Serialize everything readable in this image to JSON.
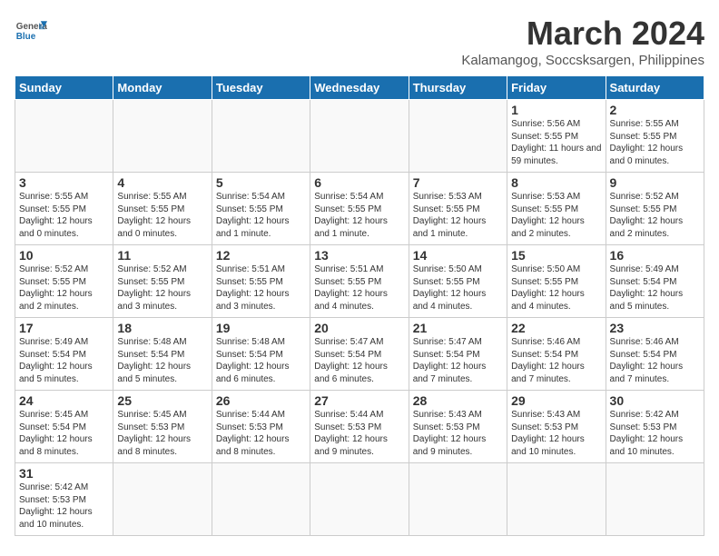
{
  "header": {
    "logo_general": "General",
    "logo_blue": "Blue",
    "month_title": "March 2024",
    "location": "Kalamangog, Soccsksargen, Philippines"
  },
  "days_of_week": [
    "Sunday",
    "Monday",
    "Tuesday",
    "Wednesday",
    "Thursday",
    "Friday",
    "Saturday"
  ],
  "weeks": [
    [
      {
        "day": "",
        "info": ""
      },
      {
        "day": "",
        "info": ""
      },
      {
        "day": "",
        "info": ""
      },
      {
        "day": "",
        "info": ""
      },
      {
        "day": "",
        "info": ""
      },
      {
        "day": "1",
        "info": "Sunrise: 5:56 AM\nSunset: 5:55 PM\nDaylight: 11 hours and 59 minutes."
      },
      {
        "day": "2",
        "info": "Sunrise: 5:55 AM\nSunset: 5:55 PM\nDaylight: 12 hours and 0 minutes."
      }
    ],
    [
      {
        "day": "3",
        "info": "Sunrise: 5:55 AM\nSunset: 5:55 PM\nDaylight: 12 hours and 0 minutes."
      },
      {
        "day": "4",
        "info": "Sunrise: 5:55 AM\nSunset: 5:55 PM\nDaylight: 12 hours and 0 minutes."
      },
      {
        "day": "5",
        "info": "Sunrise: 5:54 AM\nSunset: 5:55 PM\nDaylight: 12 hours and 1 minute."
      },
      {
        "day": "6",
        "info": "Sunrise: 5:54 AM\nSunset: 5:55 PM\nDaylight: 12 hours and 1 minute."
      },
      {
        "day": "7",
        "info": "Sunrise: 5:53 AM\nSunset: 5:55 PM\nDaylight: 12 hours and 1 minute."
      },
      {
        "day": "8",
        "info": "Sunrise: 5:53 AM\nSunset: 5:55 PM\nDaylight: 12 hours and 2 minutes."
      },
      {
        "day": "9",
        "info": "Sunrise: 5:52 AM\nSunset: 5:55 PM\nDaylight: 12 hours and 2 minutes."
      }
    ],
    [
      {
        "day": "10",
        "info": "Sunrise: 5:52 AM\nSunset: 5:55 PM\nDaylight: 12 hours and 2 minutes."
      },
      {
        "day": "11",
        "info": "Sunrise: 5:52 AM\nSunset: 5:55 PM\nDaylight: 12 hours and 3 minutes."
      },
      {
        "day": "12",
        "info": "Sunrise: 5:51 AM\nSunset: 5:55 PM\nDaylight: 12 hours and 3 minutes."
      },
      {
        "day": "13",
        "info": "Sunrise: 5:51 AM\nSunset: 5:55 PM\nDaylight: 12 hours and 4 minutes."
      },
      {
        "day": "14",
        "info": "Sunrise: 5:50 AM\nSunset: 5:55 PM\nDaylight: 12 hours and 4 minutes."
      },
      {
        "day": "15",
        "info": "Sunrise: 5:50 AM\nSunset: 5:55 PM\nDaylight: 12 hours and 4 minutes."
      },
      {
        "day": "16",
        "info": "Sunrise: 5:49 AM\nSunset: 5:54 PM\nDaylight: 12 hours and 5 minutes."
      }
    ],
    [
      {
        "day": "17",
        "info": "Sunrise: 5:49 AM\nSunset: 5:54 PM\nDaylight: 12 hours and 5 minutes."
      },
      {
        "day": "18",
        "info": "Sunrise: 5:48 AM\nSunset: 5:54 PM\nDaylight: 12 hours and 5 minutes."
      },
      {
        "day": "19",
        "info": "Sunrise: 5:48 AM\nSunset: 5:54 PM\nDaylight: 12 hours and 6 minutes."
      },
      {
        "day": "20",
        "info": "Sunrise: 5:47 AM\nSunset: 5:54 PM\nDaylight: 12 hours and 6 minutes."
      },
      {
        "day": "21",
        "info": "Sunrise: 5:47 AM\nSunset: 5:54 PM\nDaylight: 12 hours and 7 minutes."
      },
      {
        "day": "22",
        "info": "Sunrise: 5:46 AM\nSunset: 5:54 PM\nDaylight: 12 hours and 7 minutes."
      },
      {
        "day": "23",
        "info": "Sunrise: 5:46 AM\nSunset: 5:54 PM\nDaylight: 12 hours and 7 minutes."
      }
    ],
    [
      {
        "day": "24",
        "info": "Sunrise: 5:45 AM\nSunset: 5:54 PM\nDaylight: 12 hours and 8 minutes."
      },
      {
        "day": "25",
        "info": "Sunrise: 5:45 AM\nSunset: 5:53 PM\nDaylight: 12 hours and 8 minutes."
      },
      {
        "day": "26",
        "info": "Sunrise: 5:44 AM\nSunset: 5:53 PM\nDaylight: 12 hours and 8 minutes."
      },
      {
        "day": "27",
        "info": "Sunrise: 5:44 AM\nSunset: 5:53 PM\nDaylight: 12 hours and 9 minutes."
      },
      {
        "day": "28",
        "info": "Sunrise: 5:43 AM\nSunset: 5:53 PM\nDaylight: 12 hours and 9 minutes."
      },
      {
        "day": "29",
        "info": "Sunrise: 5:43 AM\nSunset: 5:53 PM\nDaylight: 12 hours and 10 minutes."
      },
      {
        "day": "30",
        "info": "Sunrise: 5:42 AM\nSunset: 5:53 PM\nDaylight: 12 hours and 10 minutes."
      }
    ],
    [
      {
        "day": "31",
        "info": "Sunrise: 5:42 AM\nSunset: 5:53 PM\nDaylight: 12 hours and 10 minutes."
      },
      {
        "day": "",
        "info": ""
      },
      {
        "day": "",
        "info": ""
      },
      {
        "day": "",
        "info": ""
      },
      {
        "day": "",
        "info": ""
      },
      {
        "day": "",
        "info": ""
      },
      {
        "day": "",
        "info": ""
      }
    ]
  ]
}
